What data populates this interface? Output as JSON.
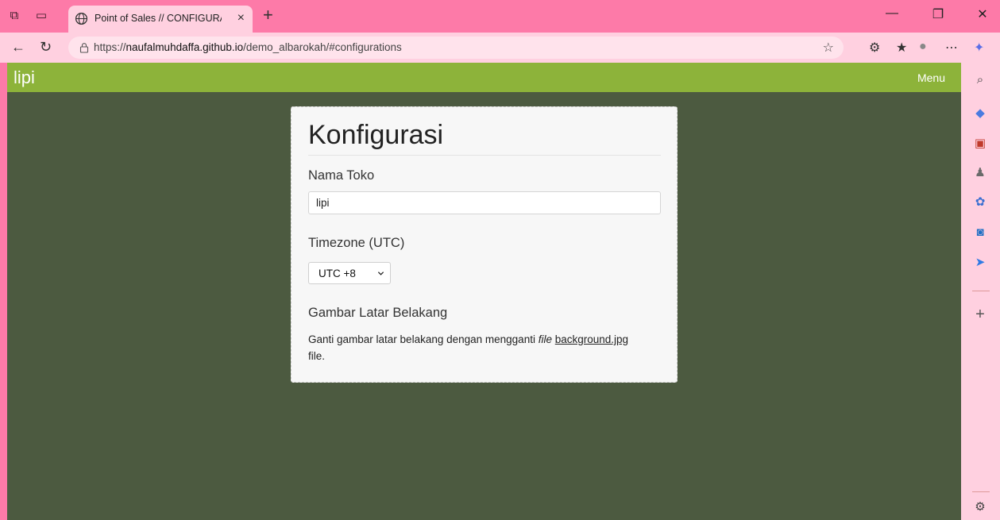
{
  "browser": {
    "tab_title": "Point of Sales // CONFIGURATION",
    "url_prefix": "https://",
    "url_domain": "naufalmuhdaffa.github.io",
    "url_path": "/demo_albarokah/#configurations",
    "new_tab_glyph": "+",
    "tab_close_glyph": "×"
  },
  "app": {
    "brand": "lipi",
    "menu_label": "Menu"
  },
  "config": {
    "title": "Konfigurasi",
    "store_name_label": "Nama Toko",
    "store_name_value": "lipi",
    "timezone_label": "Timezone (UTC)",
    "timezone_value": "UTC +8",
    "background_label": "Gambar Latar Belakang",
    "background_text_before": "Ganti gambar latar belakang dengan mengganti ",
    "background_text_italic": "file",
    "background_link": "background.jpg",
    "background_text_after": "file."
  },
  "colors": {
    "browser_frame": "#fd7aa8",
    "toolbar": "#ffd0e0",
    "app_bar": "#8db33a",
    "page_background": "#4c5a40",
    "card": "#f7f7f7"
  }
}
